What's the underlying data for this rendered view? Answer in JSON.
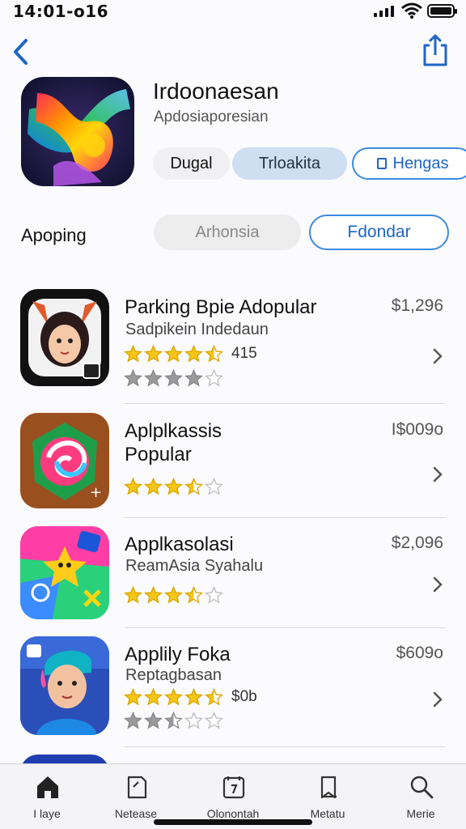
{
  "status_bar": {
    "time": "14:01-o16"
  },
  "hero": {
    "title": "Irdoonaesan",
    "subtitle": "Apdosiaporesian",
    "pills": [
      "Dugal",
      "Trloakita",
      "Hengas"
    ]
  },
  "section": {
    "label": "Apoping",
    "pill_left": "Arhonsia",
    "pill_right": "Fdondar"
  },
  "apps": [
    {
      "name": "Parking Bpie Adopular",
      "subtitle": "Sadpikein Indedaun",
      "price": "$1,296",
      "rating_text": "415",
      "rating": 4.5,
      "secondary_rating": 4
    },
    {
      "name": "Aplplkassis Popular",
      "subtitle": "",
      "price": "I$009o",
      "rating_text": "",
      "rating": 3.5,
      "secondary_rating": null
    },
    {
      "name": "Applkasolasi",
      "subtitle": "ReamAsia Syahalu",
      "price": "$2,096",
      "rating_text": "",
      "rating": 3.5,
      "secondary_rating": null
    },
    {
      "name": "Applily Foka",
      "subtitle": "Reptagbasan",
      "price": "$609o",
      "rating_text": "$0b",
      "rating": 4.5,
      "secondary_rating": 2.5
    }
  ],
  "tabs": [
    {
      "label": "I laye",
      "icon": "home-icon"
    },
    {
      "label": "Netease",
      "icon": "document-icon"
    },
    {
      "label": "Olonontah",
      "icon": "calendar-icon"
    },
    {
      "label": "Metatu",
      "icon": "bookmark-icon"
    },
    {
      "label": "Merie",
      "icon": "search-icon"
    }
  ],
  "colors": {
    "accent": "#1e66c5",
    "star": "#f5c518",
    "star_empty": "#bdbdbd"
  }
}
